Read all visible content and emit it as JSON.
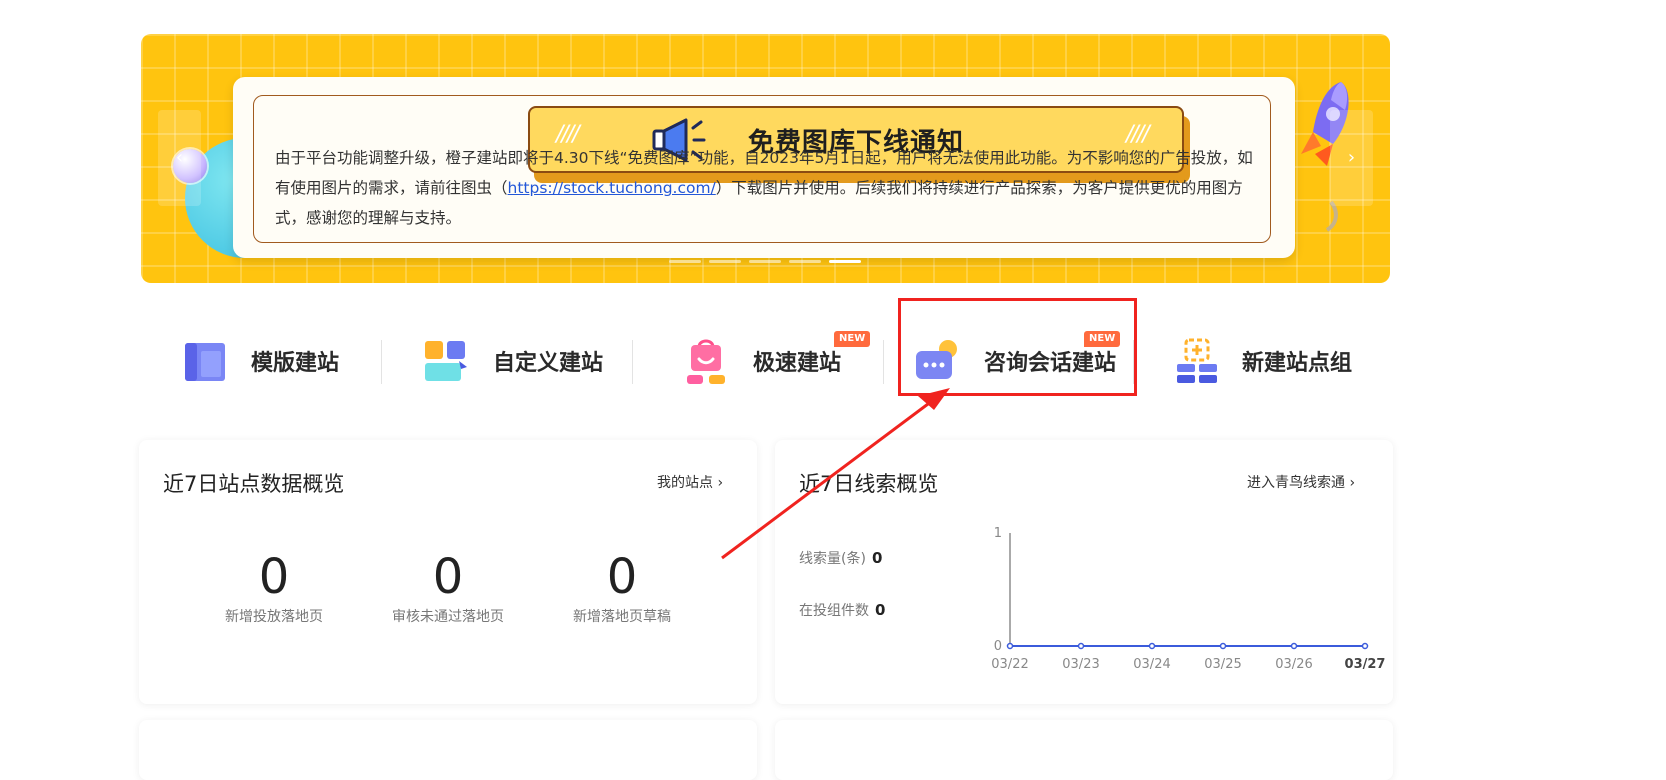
{
  "banner": {
    "notice_title": "免费图库下线通知",
    "notice_text_1": "由于平台功能调整升级，橙子建站即将于4.30下线“免费图库”功能，自2023年5月1日起，用户将无法使用此功能。为不影响您的广告投放，如有使用图片的需求，请前往图虫（",
    "notice_link": "https://stock.tuchong.com/",
    "notice_text_2": "）下载图片并使用。后续我们将持续进行产品探索，为客户提供更优的用图方式，感谢您的理解与支持。",
    "prev_icon": "‹",
    "next_icon": "›",
    "dot_count": 5,
    "active_dot": 4
  },
  "features": [
    {
      "label": "模版建站",
      "icon": "template-site-icon"
    },
    {
      "label": "自定义建站",
      "icon": "custom-site-icon"
    },
    {
      "label": "极速建站",
      "icon": "fast-site-icon",
      "badge": "NEW"
    },
    {
      "label": "咨询会话建站",
      "icon": "chat-site-icon",
      "badge": "NEW"
    },
    {
      "label": "新建站点组",
      "icon": "site-group-icon"
    }
  ],
  "site_overview": {
    "title": "近7日站点数据概览",
    "link": "我的站点 ›",
    "stats": [
      {
        "value": "0",
        "label": "新增投放落地页"
      },
      {
        "value": "0",
        "label": "审核未通过落地页"
      },
      {
        "value": "0",
        "label": "新增落地页草稿"
      }
    ]
  },
  "leads_overview": {
    "title": "近7日线索概览",
    "link": "进入青鸟线索通 ›",
    "rows": [
      {
        "label": "线索量(条)",
        "value": "0"
      },
      {
        "label": "在投组件数",
        "value": "0"
      }
    ]
  },
  "chart_data": {
    "type": "line",
    "categories": [
      "03/22",
      "03/23",
      "03/24",
      "03/25",
      "03/26",
      "03/27"
    ],
    "series": [
      {
        "values": [
          0,
          0,
          0,
          0,
          0,
          0
        ]
      }
    ],
    "yticks": [
      "0",
      "1"
    ],
    "ylim": [
      0,
      1
    ],
    "color": "#3b5bdb"
  },
  "colors": {
    "banner": "#ffc40f",
    "highlight": "#f0231f",
    "badge": "#ff6a3d",
    "link": "#2357d8"
  }
}
